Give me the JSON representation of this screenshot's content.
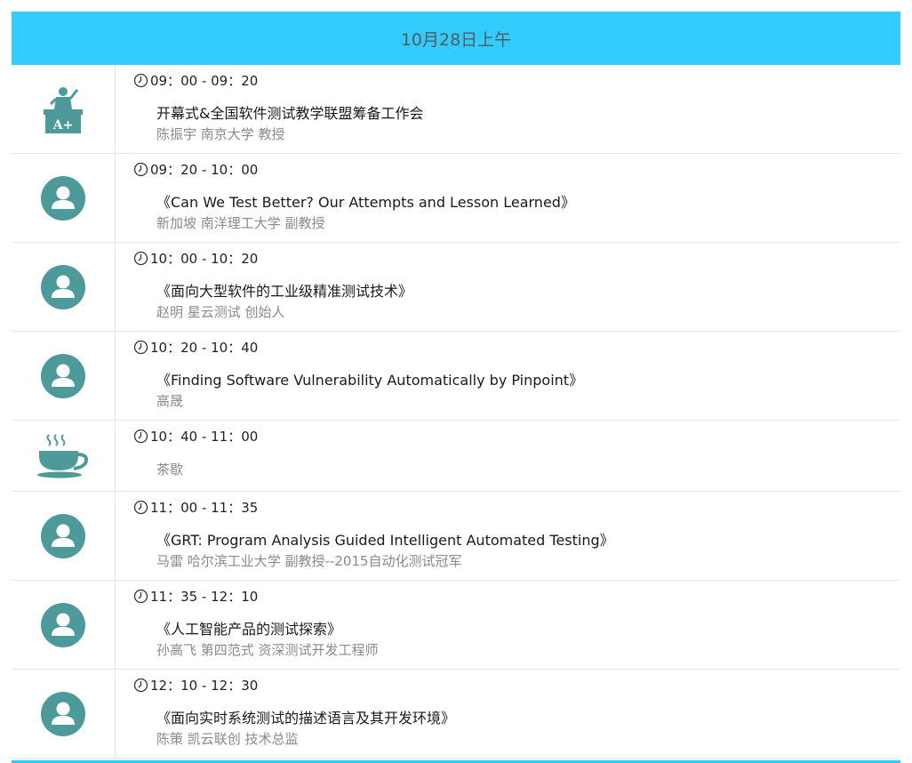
{
  "header": {
    "title": "10月28日上午"
  },
  "colors": {
    "header_bg": "#33ccff",
    "icon_teal": "#4e9a9a",
    "title_text": "#1a1a1a",
    "speaker_text": "#8a8a8a"
  },
  "sessions": [
    {
      "time": "09：00 - 09：20",
      "title": "开幕式&全国软件测试教学联盟筹备工作会",
      "speaker": "陈振宇 南京大学 教授",
      "icon": "grade-a-plus-icon"
    },
    {
      "time": "09：20 - 10：00",
      "title": "《Can We Test Better? Our Attempts and Lesson Learned》",
      "speaker": "新加坡 南洋理工大学 副教授",
      "icon": "user-avatar-icon"
    },
    {
      "time": "10：00 - 10：20",
      "title": "《面向大型软件的工业级精准测试技术》",
      "speaker": "赵明 星云测试 创始人",
      "icon": "user-avatar-icon"
    },
    {
      "time": "10：20 - 10：40",
      "title": "《Finding Software Vulnerability Automatically by Pinpoint》",
      "speaker": "高晟",
      "icon": "user-avatar-icon"
    },
    {
      "time": "10：40 - 11：00",
      "title": "",
      "speaker": "茶歇",
      "icon": "coffee-cup-icon"
    },
    {
      "time": "11：00 - 11：35",
      "title": "《GRT: Program Analysis Guided Intelligent Automated Testing》",
      "speaker": "马雷 哈尔滨工业大学 副教授--2015自动化测试冠军",
      "icon": "user-avatar-icon"
    },
    {
      "time": "11：35 - 12：10",
      "title": "《人工智能产品的测试探索》",
      "speaker": "孙高飞 第四范式 资深测试开发工程师",
      "icon": "user-avatar-icon"
    },
    {
      "time": "12：10 - 12：30",
      "title": "《面向实时系统测试的描述语言及其开发环境》",
      "speaker": "陈策 凯云联创 技术总监",
      "icon": "user-avatar-icon"
    }
  ]
}
